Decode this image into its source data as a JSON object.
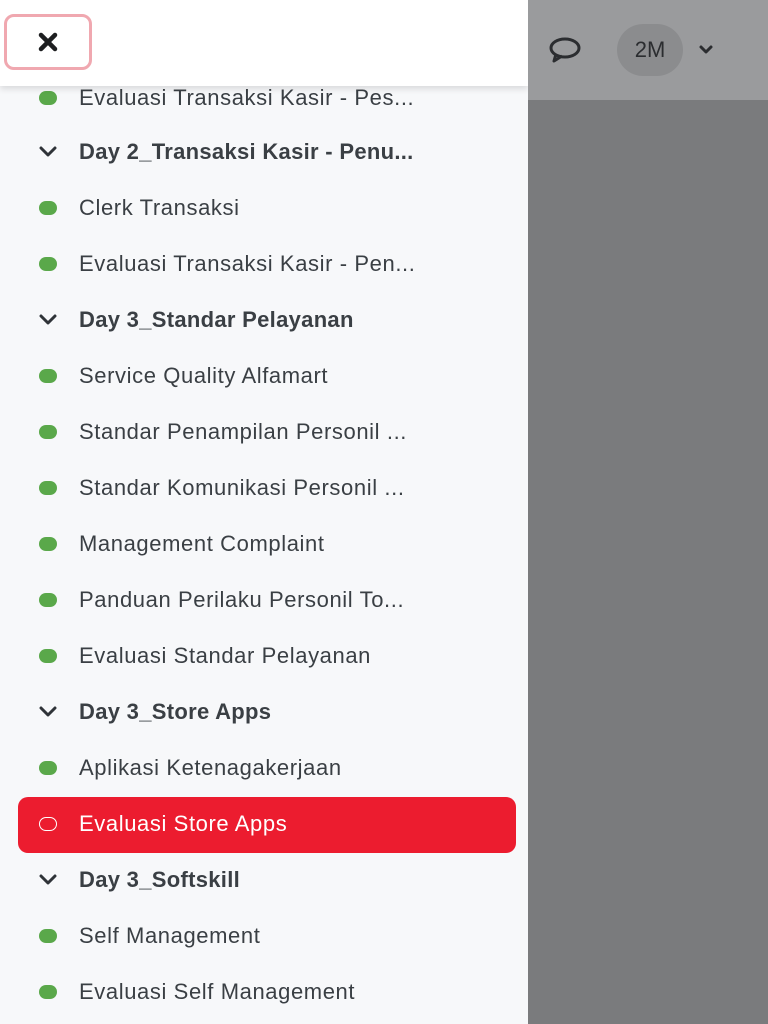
{
  "header": {
    "close_icon": "close-icon",
    "message_icon": "speech-bubble-icon",
    "user_initials": "2M",
    "user_menu_icon": "chevron-down-icon"
  },
  "colors": {
    "active_bg": "#ec1c2f",
    "complete_dot": "#5aa84a",
    "drawer_bg": "#f7f8fa",
    "backdrop": "#7a7b7d"
  },
  "items": [
    {
      "type": "lesson",
      "label": "Evaluasi Transaksi Kasir - Pes...",
      "status": "complete"
    },
    {
      "type": "section",
      "label": "Day 2_Transaksi Kasir - Penu..."
    },
    {
      "type": "lesson",
      "label": "Clerk Transaksi",
      "status": "complete"
    },
    {
      "type": "lesson",
      "label": "Evaluasi Transaksi Kasir - Pen...",
      "status": "complete"
    },
    {
      "type": "section",
      "label": "Day 3_Standar Pelayanan"
    },
    {
      "type": "lesson",
      "label": "Service Quality Alfamart",
      "status": "complete"
    },
    {
      "type": "lesson",
      "label": "Standar Penampilan Personil ...",
      "status": "complete"
    },
    {
      "type": "lesson",
      "label": "Standar Komunikasi Personil ...",
      "status": "complete"
    },
    {
      "type": "lesson",
      "label": "Management Complaint",
      "status": "complete"
    },
    {
      "type": "lesson",
      "label": "Panduan Perilaku Personil To...",
      "status": "complete"
    },
    {
      "type": "lesson",
      "label": "Evaluasi Standar Pelayanan",
      "status": "complete"
    },
    {
      "type": "section",
      "label": "Day 3_Store Apps"
    },
    {
      "type": "lesson",
      "label": "Aplikasi Ketenagakerjaan",
      "status": "complete"
    },
    {
      "type": "lesson",
      "label": "Evaluasi Store Apps",
      "status": "active"
    },
    {
      "type": "section",
      "label": "Day 3_Softskill"
    },
    {
      "type": "lesson",
      "label": "Self Management",
      "status": "complete"
    },
    {
      "type": "lesson",
      "label": "Evaluasi Self Management",
      "status": "complete"
    }
  ]
}
